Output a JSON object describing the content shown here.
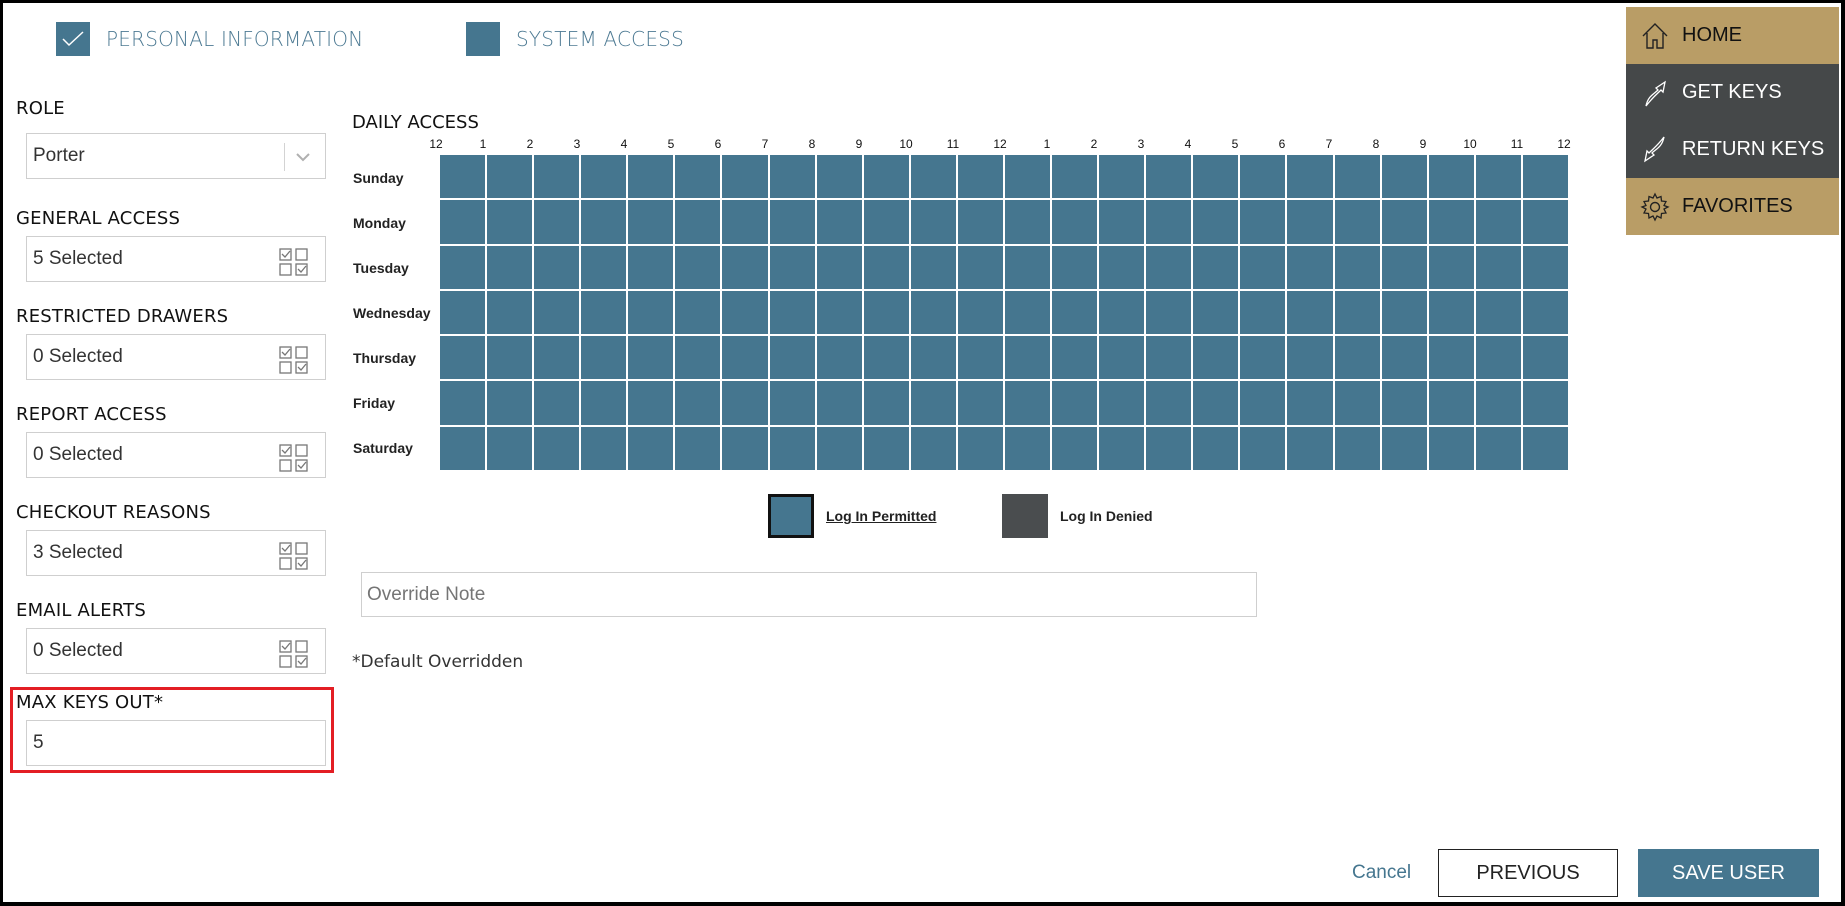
{
  "steps": [
    {
      "label": "PERSONAL INFORMATION",
      "completed": true
    },
    {
      "label": "SYSTEM ACCESS",
      "completed": false
    }
  ],
  "form": {
    "role": {
      "label": "ROLE",
      "value": "Porter"
    },
    "general_access": {
      "label": "GENERAL ACCESS",
      "value": "5 Selected"
    },
    "restricted_drawers": {
      "label": "RESTRICTED DRAWERS",
      "value": "0 Selected"
    },
    "report_access": {
      "label": "REPORT ACCESS",
      "value": "0 Selected"
    },
    "checkout_reasons": {
      "label": "CHECKOUT REASONS",
      "value": "3 Selected"
    },
    "email_alerts": {
      "label": "EMAIL ALERTS",
      "value": "0 Selected"
    },
    "max_keys_out": {
      "label": "MAX KEYS OUT*",
      "value": "5"
    }
  },
  "daily_access": {
    "title": "DAILY ACCESS",
    "hours": [
      "12",
      "1",
      "2",
      "3",
      "4",
      "5",
      "6",
      "7",
      "8",
      "9",
      "10",
      "11",
      "12",
      "1",
      "2",
      "3",
      "4",
      "5",
      "6",
      "7",
      "8",
      "9",
      "10",
      "11",
      "12"
    ],
    "days": [
      "Sunday",
      "Monday",
      "Tuesday",
      "Wednesday",
      "Thursday",
      "Friday",
      "Saturday"
    ],
    "cells_permitted": "all"
  },
  "legend": {
    "permitted": "Log In Permitted",
    "denied": "Log In Denied"
  },
  "override_note": {
    "placeholder": "Override Note"
  },
  "default_note": "*Default Overridden",
  "nav": {
    "home": "HOME",
    "get_keys": "GET KEYS",
    "return_keys": "RETURN KEYS",
    "favorites": "FAVORITES"
  },
  "buttons": {
    "cancel": "Cancel",
    "previous": "PREVIOUS",
    "save": "SAVE USER"
  },
  "colors": {
    "accent": "#45768f",
    "nav_gold": "#b99d66",
    "nav_dark": "#454849",
    "denied": "#4a4d4f",
    "highlight": "#e31e24"
  }
}
